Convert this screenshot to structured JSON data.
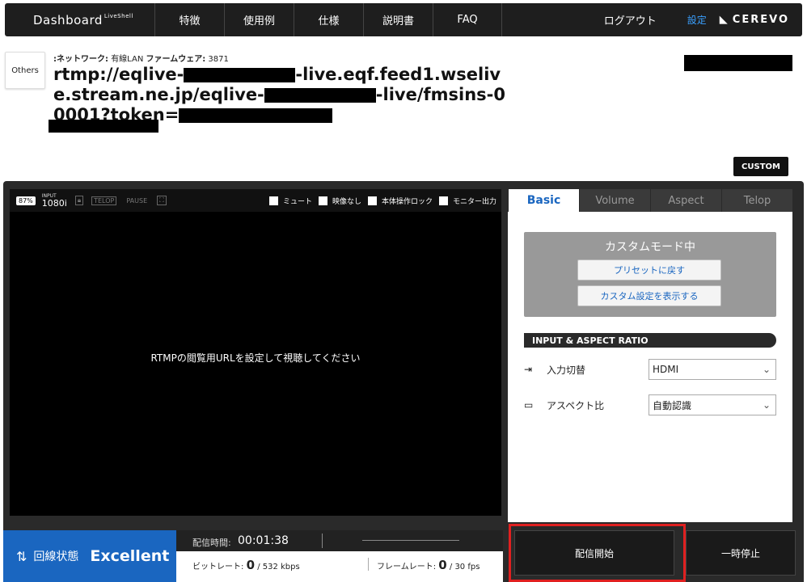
{
  "nav": {
    "brand": "Dashboard",
    "brand_sup": "LiveShell",
    "items": [
      "特徴",
      "使用例",
      "仕様",
      "説明書",
      "FAQ"
    ],
    "logout": "ログアウト",
    "settings": "設定",
    "logo": "CEREVO"
  },
  "info": {
    "others_label": "Others",
    "network_label": ":ネットワーク:",
    "network_value": "有線LAN",
    "firmware_label": "ファームウェア:",
    "firmware_value": "3871",
    "url_parts": [
      "rtmp://eqlive-",
      "-live.eqf.feed1.wselive.stream.ne.jp/eqlive-",
      "-live/fmsins-00001?token="
    ]
  },
  "custom_button": "CUSTOM",
  "video": {
    "battery": "87%",
    "input_label": "INPUT",
    "input_value": "1080i",
    "icons": [
      "lock-icon",
      "telop-icon",
      "pause-icon",
      "crop-icon"
    ],
    "telop_label": "TELOP",
    "pause_label": "PAUSE",
    "checkboxes": [
      "ミュート",
      "映像なし",
      "本体操作ロック",
      "モニター出力"
    ],
    "message": "RTMPの閲覧用URLを設定して視聴してください"
  },
  "tabs": [
    "Basic",
    "Volume",
    "Aspect",
    "Telop"
  ],
  "basic": {
    "mode_title": "カスタムモード中",
    "preset_button": "プリセットに戻す",
    "show_custom_button": "カスタム設定を表示する",
    "section_title": "INPUT & ASPECT RATIO",
    "input_switch_label": "入力切替",
    "input_switch_value": "HDMI",
    "aspect_label": "アスペクト比",
    "aspect_value": "自動認識"
  },
  "status": {
    "line_label": "回線状態",
    "line_value": "Excellent",
    "time_label": "配信時間:",
    "time_value": "00:01:38",
    "bitrate_label": "ビットレート:",
    "bitrate_value": "0",
    "bitrate_max": "/ 532 kbps",
    "framerate_label": "フレームレート:",
    "framerate_value": "0",
    "framerate_max": "/ 30 fps"
  },
  "actions": {
    "start": "配信開始",
    "pause": "一時停止"
  },
  "colors": {
    "accent_blue": "#1a66c0",
    "highlight_red": "#e02020"
  }
}
